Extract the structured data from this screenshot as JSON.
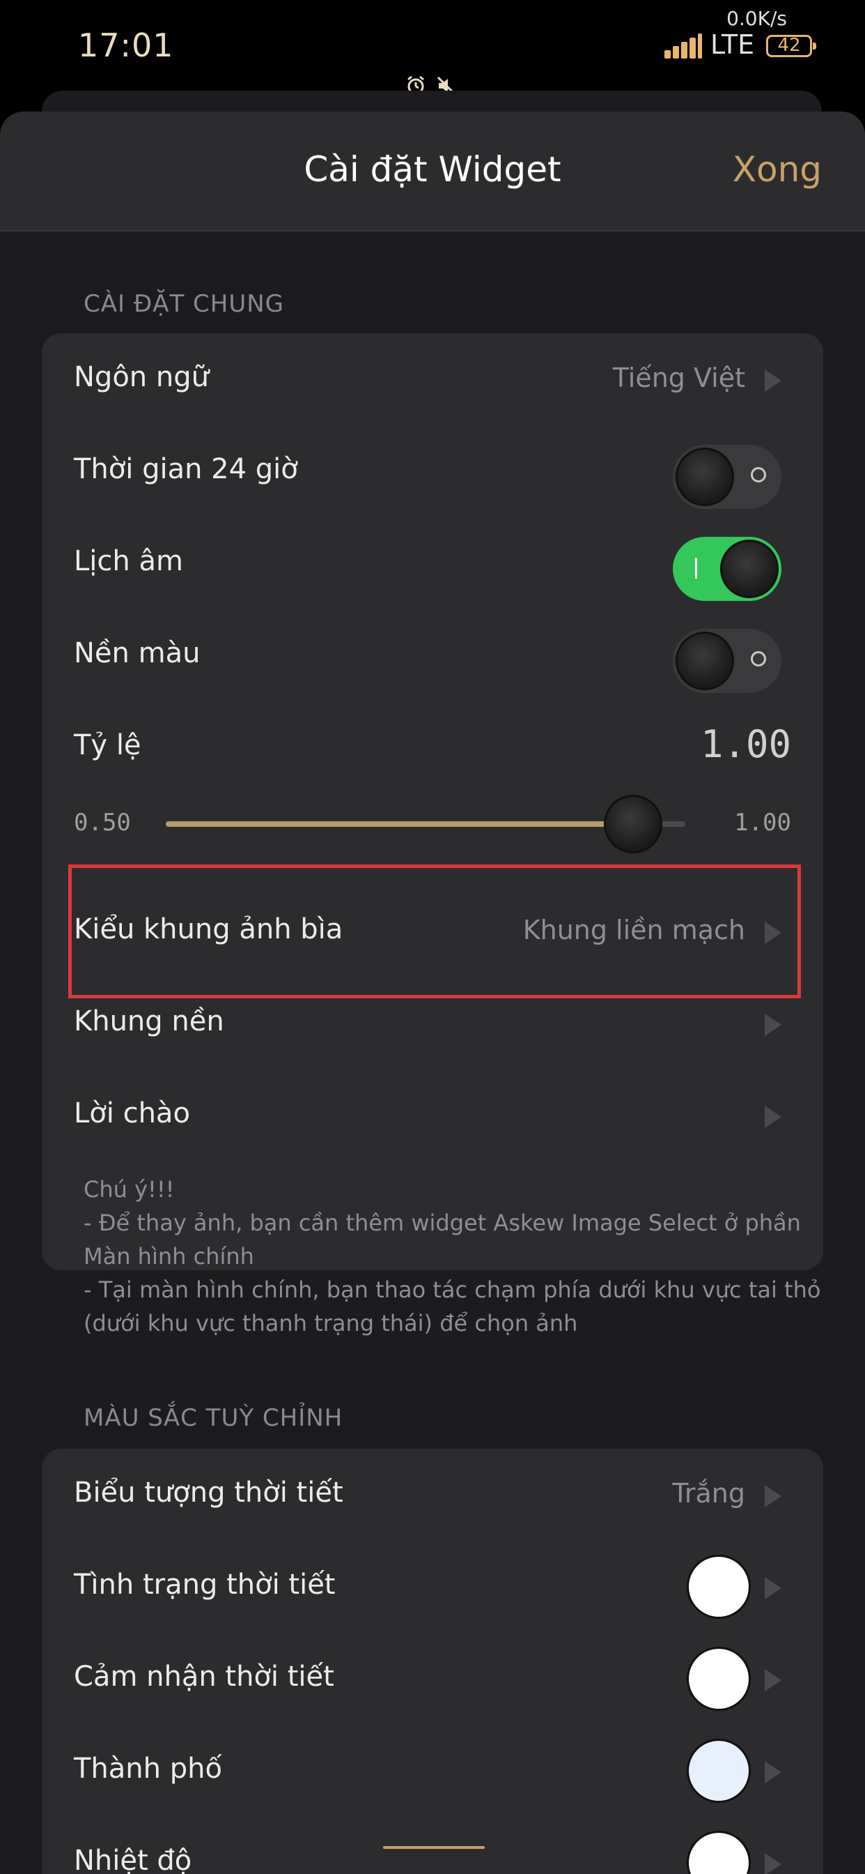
{
  "status_bar": {
    "time": "17:01",
    "net_speed": "0.0K/s",
    "network": "LTE",
    "battery": "42"
  },
  "header": {
    "title": "Cài đặt Widget",
    "done": "Xong"
  },
  "general": {
    "section_label": "CÀI ĐẶT CHUNG",
    "language": {
      "label": "Ngôn ngữ",
      "value": "Tiếng Việt"
    },
    "time24": {
      "label": "Thời gian 24 giờ",
      "on": false
    },
    "lunar": {
      "label": "Lịch âm",
      "on": true
    },
    "background_color": {
      "label": "Nền màu",
      "on": false
    },
    "scale": {
      "label": "Tỷ lệ",
      "value": "1.00",
      "min": "0.50",
      "max": "1.00",
      "fraction": 0.9
    },
    "cover_frame": {
      "label": "Kiểu khung ảnh bìa",
      "value": "Khung liền mạch"
    },
    "background_frame": {
      "label": "Khung nền"
    },
    "greeting": {
      "label": "Lời chào"
    }
  },
  "note": {
    "lines": [
      "Chú ý!!!",
      "- Để thay ảnh, bạn cần thêm widget Askew Image Select ở phần",
      "Màn hình chính",
      "- Tại màn hình chính, bạn thao tác chạm phía dưới khu vực tai thỏ",
      "(dưới khu vực thanh trạng thái) để chọn ảnh"
    ]
  },
  "colors": {
    "section_label": "MÀU SẮC TUỲ CHỈNH",
    "weather_icon": {
      "label": "Biểu tượng thời tiết",
      "value": "Trắng"
    },
    "weather_condition": {
      "label": "Tình trạng thời tiết",
      "color": "#ffffff"
    },
    "feels_like": {
      "label": "Cảm nhận thời tiết",
      "color": "#ffffff"
    },
    "city": {
      "label": "Thành phố",
      "color": "#e8f0fd"
    },
    "temperature": {
      "label": "Nhiệt độ",
      "color": "#ffffff"
    }
  },
  "theme": {
    "accent": "#c8a266",
    "toggle_on": "#34c759",
    "highlight": "#d9383e"
  }
}
